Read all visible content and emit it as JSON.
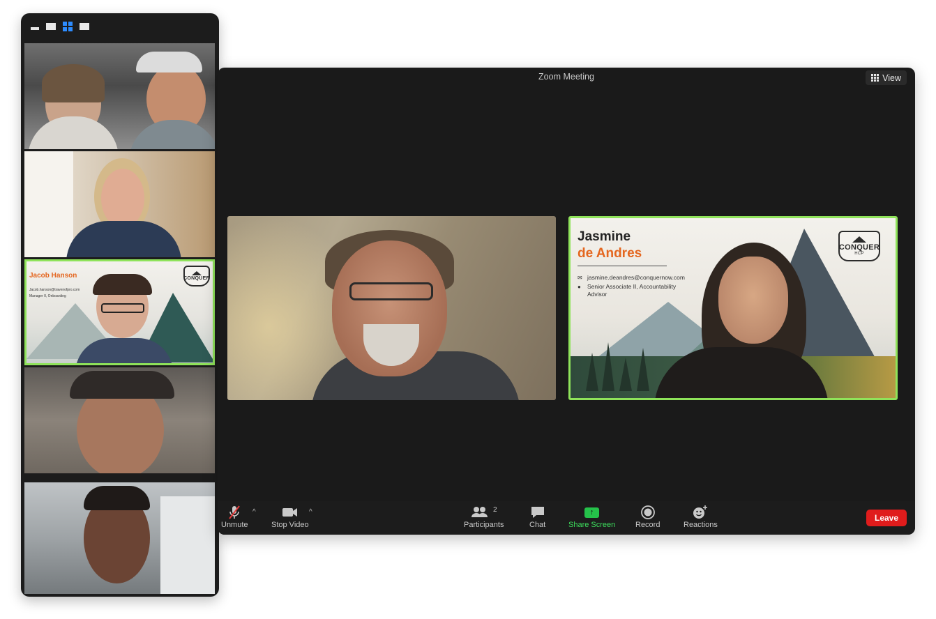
{
  "window": {
    "title": "Zoom Meeting",
    "view_label": "View"
  },
  "participant_card": {
    "first_name": "Jasmine",
    "last_name": "de Andres",
    "email": "jasmine.deandres@conquernow.com",
    "role_line1": "Senior Associate II, Accountability",
    "role_line2": "Advisor",
    "logo_text": "CONQUER",
    "logo_sub": "HCP"
  },
  "side_card": {
    "name": "Jacob Hanson",
    "email": "Jacob.hanson@travenofpro.com",
    "role": "Manager II, Onboarding",
    "logo_text": "CONQUER"
  },
  "toolbar": {
    "unmute": "Unmute",
    "stop_video": "Stop Video",
    "participants": "Participants",
    "participants_count": "2",
    "chat": "Chat",
    "share_screen": "Share Screen",
    "record": "Record",
    "reactions": "Reactions",
    "leave": "Leave"
  },
  "colors": {
    "accent_green": "#8fe35a",
    "share_green": "#25c24a",
    "leave_red": "#e01c1c",
    "brand_orange": "#e4661f",
    "gallery_blue": "#2d8cff"
  },
  "icons": [
    "mic-muted-icon",
    "video-camera-icon",
    "participants-icon",
    "chat-icon",
    "share-screen-icon",
    "record-icon",
    "reactions-icon",
    "grid-view-icon"
  ]
}
